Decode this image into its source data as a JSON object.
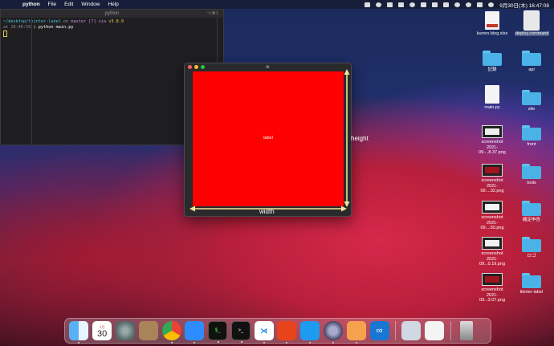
{
  "menubar": {
    "app": "python",
    "items": [
      "File",
      "Edit",
      "Window",
      "Help"
    ],
    "clock": "9月30日(木)  16:47:08"
  },
  "terminal": {
    "title": "python",
    "shortcut": "⌥⌘1",
    "line1_path": "~/desktop/tkinter-label",
    "line1_on": "on",
    "line1_branch": "master [?] via",
    "line1_version": "v3.8.9",
    "line2": "at 16:46:59",
    "line3_cmd": "python main.py"
  },
  "tk": {
    "title": "tk",
    "label": "label",
    "width_label": "width",
    "height_label": "height"
  },
  "desktop": {
    "kuroro": "kuroro.blog.xlsx",
    "deploy": "deploy.command",
    "folder_kiroku": "記録",
    "folder_api": "api",
    "main_py": "main.py",
    "folder_site": "site",
    "folder_front": "front",
    "folder_tools": "tools",
    "folder_kakutei": "確定申告",
    "folder_logo": "ロゴ",
    "folder_tkinter": "tkinter-label",
    "shot1_a": "screenshot",
    "shot1_b": "2021-09....8.37.png",
    "shot2_a": "screenshot",
    "shot2_b": "2021-09....32.png",
    "shot3_a": "screenshot",
    "shot3_b": "2021-09....50.png",
    "shot4_a": "screenshot",
    "shot4_b": "2021-09...0.19.png",
    "shot5_a": "screenshot",
    "shot5_b": "2021-09...3.07.png"
  },
  "dock": {
    "calendar_month": "9月",
    "calendar_day": "30",
    "items": [
      "finder",
      "calendar",
      "system-preferences",
      "contacts",
      "chrome",
      "zoom",
      "activity-monitor",
      "terminal",
      "vscode",
      "copilot",
      "docker",
      "quicktime",
      "preview",
      "infinity"
    ]
  }
}
